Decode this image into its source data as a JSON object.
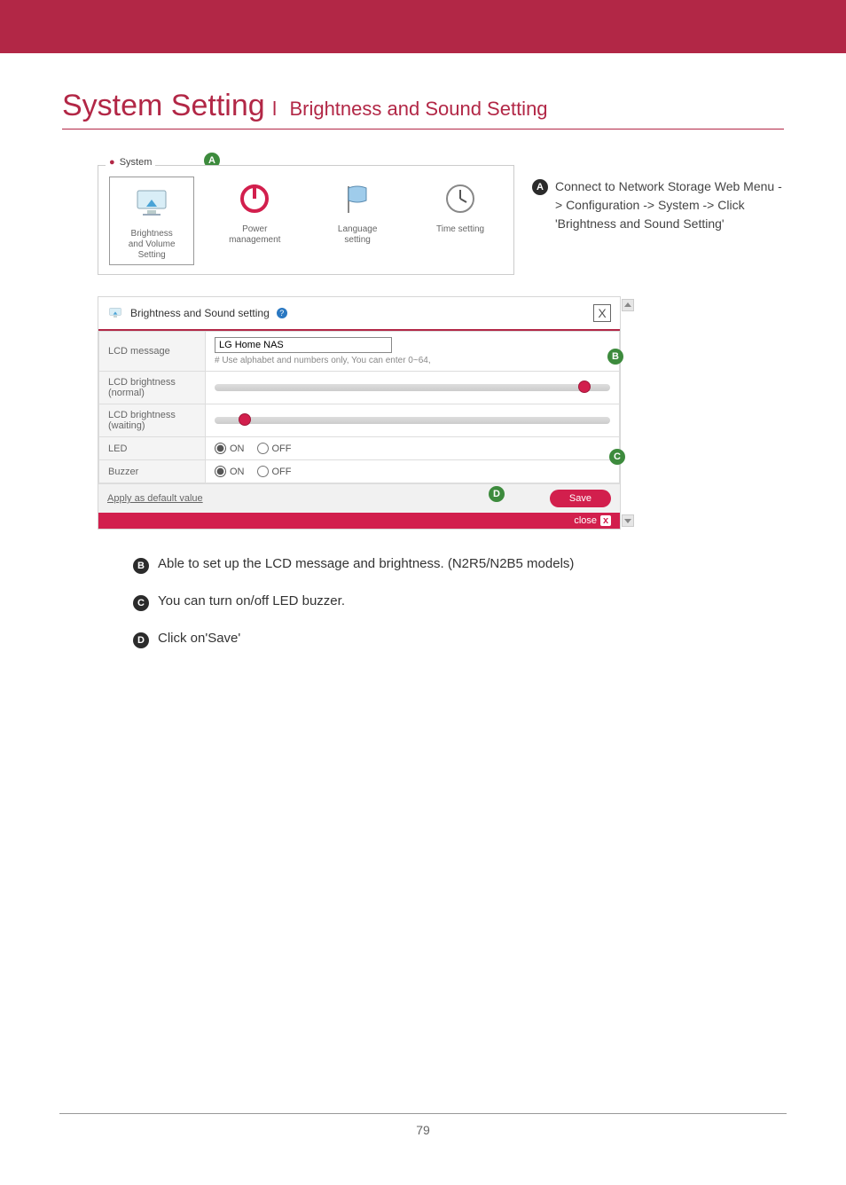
{
  "title": {
    "main": "System Setting",
    "sub": "Brightness and Sound Setting"
  },
  "system_box": {
    "label": "System",
    "items": [
      {
        "caption": "Brightness\nand Volume\nSetting"
      },
      {
        "caption": "Power\nmanagement"
      },
      {
        "caption": "Language\nsetting"
      },
      {
        "caption": "Time setting"
      }
    ]
  },
  "callout_a": "Connect to Network Storage Web Menu -> Configuration -> System -> Click 'Brightness and Sound Setting'",
  "dialog": {
    "header": "Brightness and Sound setting",
    "rows": {
      "lcd_message_label": "LCD message",
      "lcd_message_value": "LG Home NAS",
      "lcd_message_hint": "# Use alphabet and numbers only, You can enter 0~64,",
      "lcd_bright_norm_label": "LCD brightness\n(normal)",
      "lcd_bright_wait_label": "LCD brightness\n(waiting)",
      "led_label": "LED",
      "buzzer_label": "Buzzer",
      "on": "ON",
      "off": "OFF"
    },
    "footer": {
      "default_link": "Apply as default value",
      "save": "Save",
      "close": "close"
    }
  },
  "notes": {
    "b": "Able to set up the LCD message and brightness. (N2R5/N2B5 models)",
    "c": "You can turn on/off LED buzzer.",
    "d": "Click on'Save'"
  },
  "badges": {
    "a": "A",
    "b": "B",
    "c": "C",
    "d": "D"
  },
  "close_x": "X",
  "help": "?",
  "page_number": "79",
  "chart_data": {
    "type": "table",
    "settings": [
      {
        "name": "LCD message",
        "value": "LG Home NAS"
      },
      {
        "name": "LCD brightness (normal)",
        "value_percent": 92
      },
      {
        "name": "LCD brightness (waiting)",
        "value_percent": 6
      },
      {
        "name": "LED",
        "value": "ON"
      },
      {
        "name": "Buzzer",
        "value": "ON"
      }
    ]
  }
}
